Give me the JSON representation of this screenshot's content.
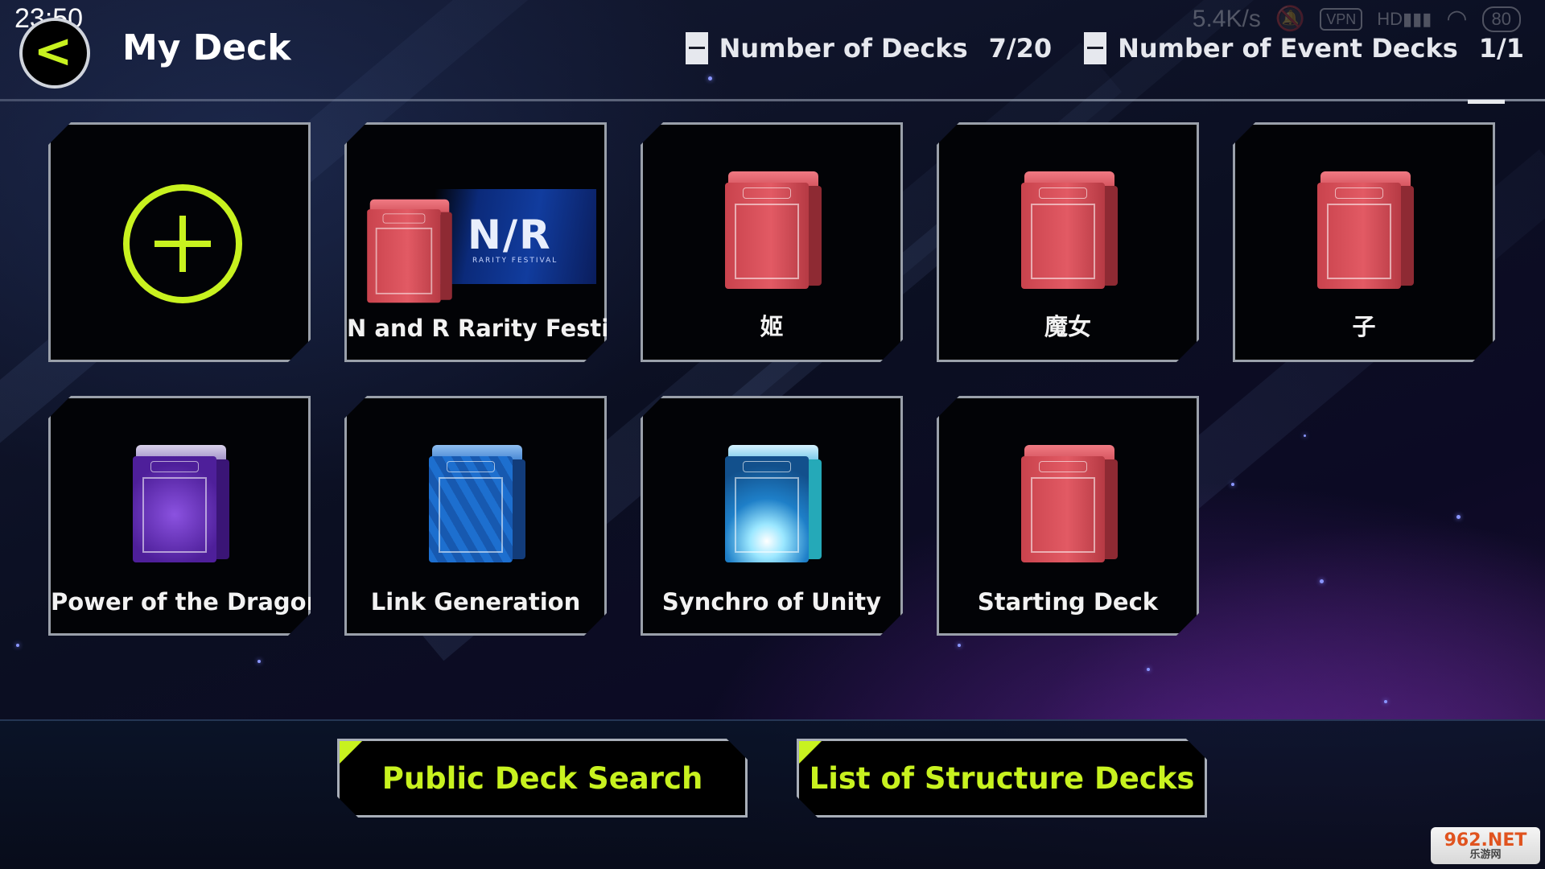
{
  "status_bar": {
    "time": "23:50",
    "net_speed": "5.4K/s",
    "vpn": "VPN",
    "hd": "HD",
    "battery": "80"
  },
  "header": {
    "title": "My Deck",
    "decks_label": "Number of Decks",
    "decks_value": "7/20",
    "event_decks_label": "Number of Event Decks",
    "event_decks_value": "1/1"
  },
  "decks": [
    {
      "label": "N and R Rarity Festival",
      "color": "red",
      "banner": "N/R",
      "banner_sub": "RARITY FESTIVAL"
    },
    {
      "label": "姬",
      "color": "red"
    },
    {
      "label": "魔女",
      "color": "red"
    },
    {
      "label": "子",
      "color": "red"
    },
    {
      "label": "Power of the Dragon",
      "color": "purple"
    },
    {
      "label": "Link Generation",
      "color": "blue"
    },
    {
      "label": "Synchro of Unity",
      "color": "teal"
    },
    {
      "label": "Starting Deck",
      "color": "red"
    }
  ],
  "actions": {
    "public_search": "Public Deck Search",
    "structure_decks": "List of Structure Decks"
  },
  "watermark": {
    "top": "962.NET",
    "bottom": "乐游网"
  },
  "colors": {
    "accent": "#c8f21f",
    "tile_border": "#9aa0aa",
    "background": "#0a0d1c"
  }
}
